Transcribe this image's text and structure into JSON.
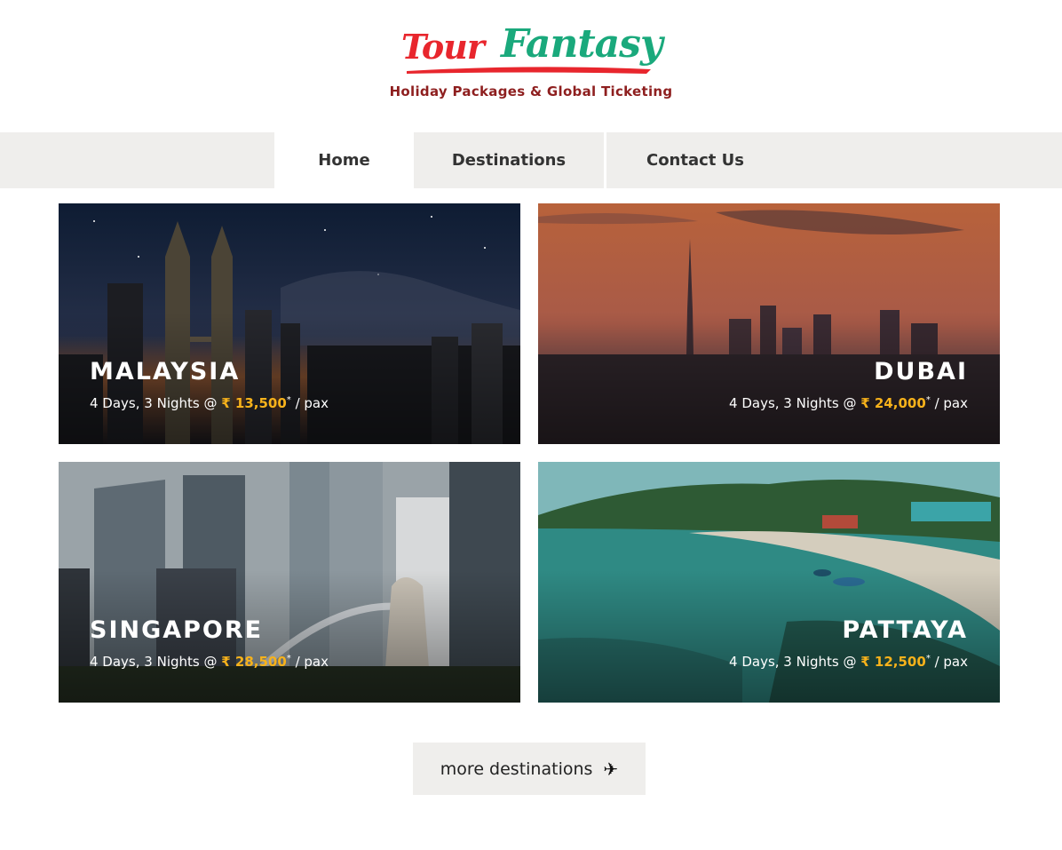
{
  "brand": {
    "logo_word1": "Tour",
    "logo_word2": "Fantasy",
    "tagline": "Holiday Packages & Global Ticketing",
    "colors": {
      "red": "#e8262d",
      "green": "#1aa97c",
      "tagline": "#8e1f1f"
    }
  },
  "nav": {
    "items": [
      {
        "label": "Home",
        "active": true
      },
      {
        "label": "Destinations",
        "active": false
      },
      {
        "label": "Contact Us",
        "active": false
      }
    ]
  },
  "destinations": [
    {
      "name": "MALAYSIA",
      "duration": "4 Days, 3 Nights @ ",
      "price": "₹ 13,500",
      "asterisk": "*",
      "suffix": " / pax",
      "image": "malaysia-skyline-night"
    },
    {
      "name": "DUBAI",
      "duration": "4 Days, 3 Nights @ ",
      "price": "₹ 24,000",
      "asterisk": "*",
      "suffix": " / pax",
      "image": "dubai-skyline-sunset"
    },
    {
      "name": "SINGAPORE",
      "duration": "4 Days, 3 Nights @ ",
      "price": "₹ 28,500",
      "asterisk": "*",
      "suffix": " / pax",
      "image": "singapore-merlion-towers"
    },
    {
      "name": "PATTAYA",
      "duration": "4 Days, 3 Nights @ ",
      "price": "₹ 12,500",
      "asterisk": "*",
      "suffix": " / pax",
      "image": "pattaya-beach"
    }
  ],
  "price_color": "#f7b21b",
  "more": {
    "label": "more destinations",
    "icon": "airplane-icon"
  }
}
